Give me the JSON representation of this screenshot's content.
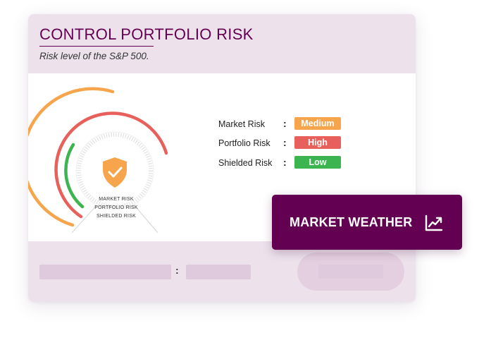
{
  "header": {
    "title": "CONTROL PORTFOLIO RISK",
    "subtitle": "Risk level of the S&P 500."
  },
  "gauge": {
    "icon": "shield-check-icon",
    "labels": [
      "MARKET RISK",
      "PORTFOLIO RISK",
      "SHIELDED RISK"
    ],
    "arc_colors": [
      "#f6a54c",
      "#e8605b",
      "#3cb44f"
    ],
    "shield_color": "#f6a54c"
  },
  "risks": [
    {
      "label": "Market Risk",
      "separator": ":",
      "level": "Medium",
      "color": "#f6a54c"
    },
    {
      "label": "Portfolio Risk",
      "separator": ":",
      "level": "High",
      "color": "#e8605b"
    },
    {
      "label": "Shielded Risk",
      "separator": ":",
      "level": "Low",
      "color": "#3cb44f"
    }
  ],
  "footer": {
    "separator": ":"
  },
  "weather_button": {
    "label": "MARKET WEATHER",
    "icon": "chart-trend-icon",
    "color": "#640051"
  }
}
